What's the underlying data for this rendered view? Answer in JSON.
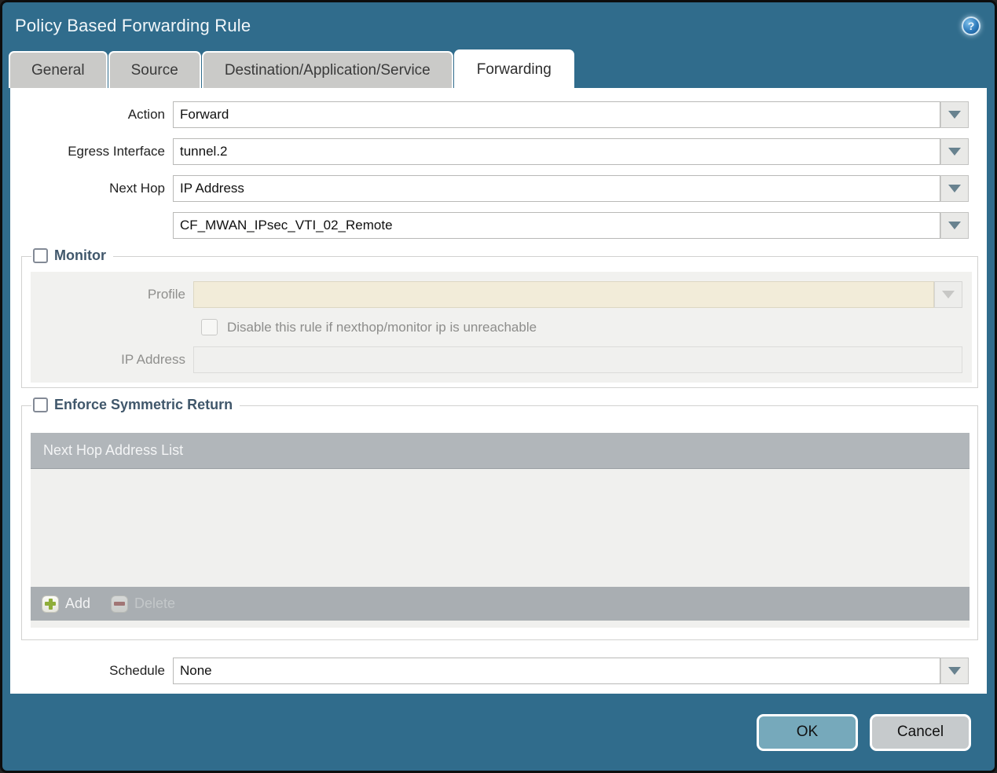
{
  "window": {
    "title": "Policy Based Forwarding Rule"
  },
  "tabs": [
    {
      "label": "General",
      "active": false
    },
    {
      "label": "Source",
      "active": false
    },
    {
      "label": "Destination/Application/Service",
      "active": false
    },
    {
      "label": "Forwarding",
      "active": true
    }
  ],
  "form": {
    "action": {
      "label": "Action",
      "value": "Forward"
    },
    "egress_interface": {
      "label": "Egress Interface",
      "value": "tunnel.2"
    },
    "next_hop": {
      "label": "Next Hop",
      "value": "IP Address"
    },
    "next_hop_address": {
      "value": "CF_MWAN_IPsec_VTI_02_Remote"
    },
    "monitor": {
      "label": "Monitor",
      "checked": false,
      "profile": {
        "label": "Profile",
        "value": ""
      },
      "disable_rule": {
        "label": "Disable this rule if nexthop/monitor ip is unreachable",
        "checked": false
      },
      "ip_address": {
        "label": "IP Address",
        "value": ""
      }
    },
    "symmetric_return": {
      "label": "Enforce Symmetric Return",
      "checked": false,
      "table": {
        "header": "Next Hop Address List",
        "rows": []
      },
      "add_label": "Add",
      "delete_label": "Delete"
    },
    "schedule": {
      "label": "Schedule",
      "value": "None"
    }
  },
  "footer": {
    "ok_label": "OK",
    "cancel_label": "Cancel"
  },
  "colors": {
    "title_bar": "#306c8c",
    "content_bg": "#ffffff",
    "inactive_tab": "#cacac8",
    "table_header": "#b1b6ba",
    "table_footer": "#a9aeb2",
    "disabled_field_beige": "#f2ecd9",
    "ok_button": "#76a9bb",
    "cancel_button": "#c6cacc",
    "add_icon_green": "#8fae3a",
    "delete_icon_red": "#9c4a44",
    "help_icon_blue": "#2f7cbd"
  }
}
